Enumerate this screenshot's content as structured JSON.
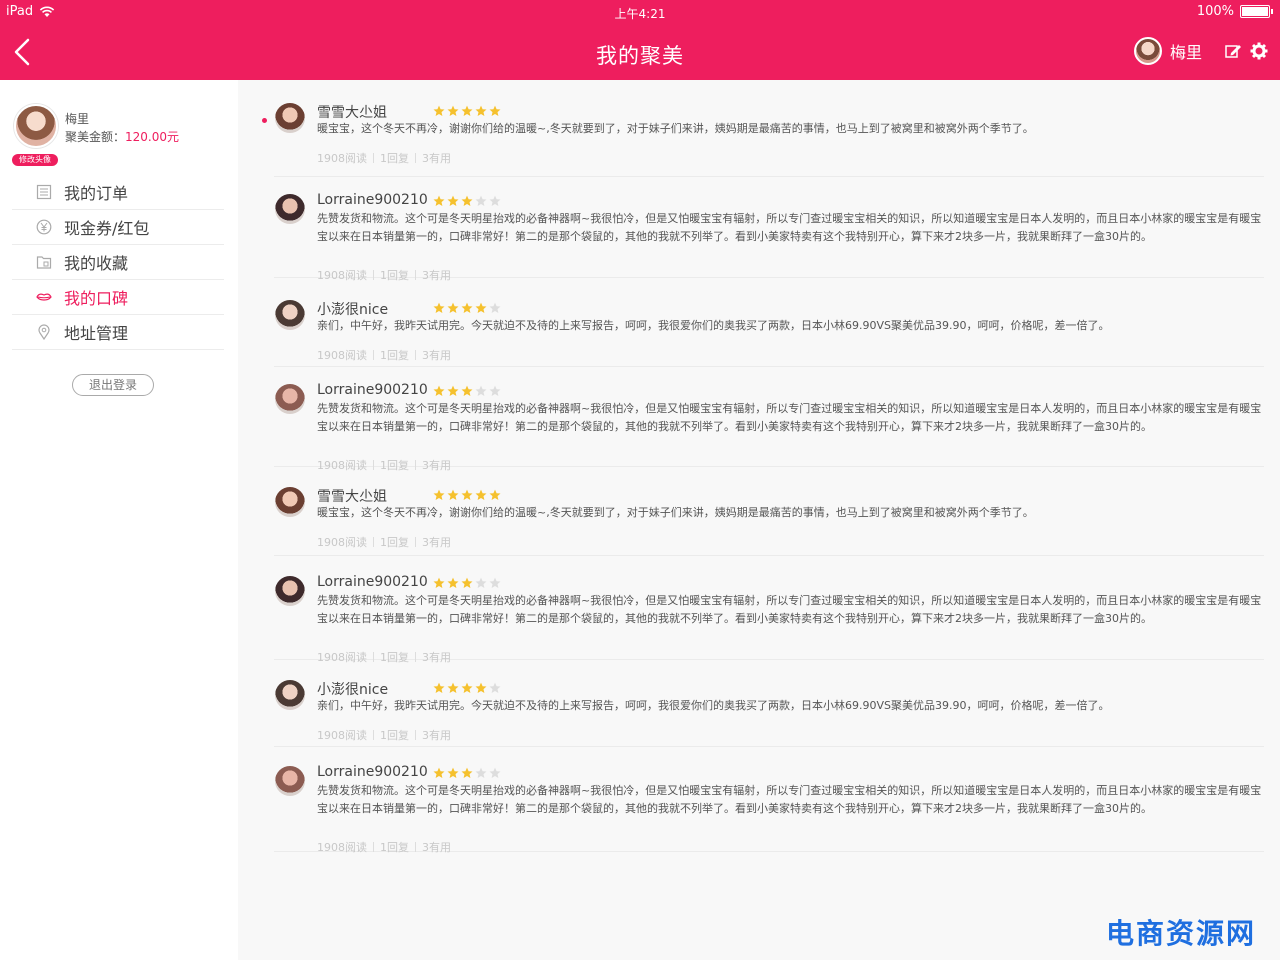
{
  "status_bar": {
    "device": "iPad",
    "time": "上午4:21",
    "battery": "100%"
  },
  "nav": {
    "title": "我的聚美",
    "username": "梅里"
  },
  "profile": {
    "name": "梅里",
    "money_label": "聚美金额：",
    "money_value": "120.00元",
    "edit_avatar_label": "修改头像"
  },
  "menu": [
    {
      "label": "我的订单",
      "icon": "order-icon"
    },
    {
      "label": "现金券/红包",
      "icon": "yen-icon"
    },
    {
      "label": "我的收藏",
      "icon": "favorites-icon"
    },
    {
      "label": "我的口碑",
      "icon": "lips-icon",
      "active": true
    },
    {
      "label": "地址管理",
      "icon": "location-icon"
    }
  ],
  "logout_label": "退出登录",
  "reviews": [
    {
      "user": "雪雪大尐姐",
      "rating": 5,
      "unread": true,
      "text": "暖宝宝，这个冬天不再冷，谢谢你们给的温暖~,冬天就要到了，对于妹子们来讲，姨妈期是最痛苦的事情，也马上到了被窝里和被窝外两个季节了。",
      "reads": "1908阅读",
      "replies": "1回复",
      "useful": "3有用"
    },
    {
      "user": "Lorraine900210",
      "rating": 3,
      "text": "先赞发货和物流。这个可是冬天明星抬戏的必备神器啊~我很怕冷，但是又怕暖宝宝有辐射，所以专门查过暖宝宝相关的知识，所以知道暖宝宝是日本人发明的，而且日本小林家的暖宝宝是有暖宝宝以来在日本销量第一的，口碑非常好！第二的是那个袋鼠的，其他的我就不列举了。看到小美家特卖有这个我特别开心，算下来才2块多一片，我就果断拜了一盒30片的。",
      "reads": "1908阅读",
      "replies": "1回复",
      "useful": "3有用"
    },
    {
      "user": "小澎很nice",
      "rating": 4,
      "text": "亲们，中午好，我昨天试用完。今天就迫不及待的上来写报告，呵呵，我很爱你们的奥我买了两款，日本小林69.90VS聚美优品39.90，呵呵，价格呢，差一倍了。",
      "reads": "1908阅读",
      "replies": "1回复",
      "useful": "3有用"
    },
    {
      "user": "Lorraine900210",
      "rating": 3,
      "text": "先赞发货和物流。这个可是冬天明星抬戏的必备神器啊~我很怕冷，但是又怕暖宝宝有辐射，所以专门查过暖宝宝相关的知识，所以知道暖宝宝是日本人发明的，而且日本小林家的暖宝宝是有暖宝宝以来在日本销量第一的，口碑非常好！第二的是那个袋鼠的，其他的我就不列举了。看到小美家特卖有这个我特别开心，算下来才2块多一片，我就果断拜了一盒30片的。",
      "reads": "1908阅读",
      "replies": "1回复",
      "useful": "3有用"
    },
    {
      "user": "雪雪大尐姐",
      "rating": 5,
      "text": "暖宝宝，这个冬天不再冷，谢谢你们给的温暖~,冬天就要到了，对于妹子们来讲，姨妈期是最痛苦的事情，也马上到了被窝里和被窝外两个季节了。",
      "reads": "1908阅读",
      "replies": "1回复",
      "useful": "3有用"
    },
    {
      "user": "Lorraine900210",
      "rating": 3,
      "text": "先赞发货和物流。这个可是冬天明星抬戏的必备神器啊~我很怕冷，但是又怕暖宝宝有辐射，所以专门查过暖宝宝相关的知识，所以知道暖宝宝是日本人发明的，而且日本小林家的暖宝宝是有暖宝宝以来在日本销量第一的，口碑非常好！第二的是那个袋鼠的，其他的我就不列举了。看到小美家特卖有这个我特别开心，算下来才2块多一片，我就果断拜了一盒30片的。",
      "reads": "1908阅读",
      "replies": "1回复",
      "useful": "3有用"
    },
    {
      "user": "小澎很nice",
      "rating": 4,
      "text": "亲们，中午好，我昨天试用完。今天就迫不及待的上来写报告，呵呵，我很爱你们的奥我买了两款，日本小林69.90VS聚美优品39.90，呵呵，价格呢，差一倍了。",
      "reads": "1908阅读",
      "replies": "1回复",
      "useful": "3有用"
    },
    {
      "user": "Lorraine900210",
      "rating": 3,
      "text": "先赞发货和物流。这个可是冬天明星抬戏的必备神器啊~我很怕冷，但是又怕暖宝宝有辐射，所以专门查过暖宝宝相关的知识，所以知道暖宝宝是日本人发明的，而且日本小林家的暖宝宝是有暖宝宝以来在日本销量第一的，口碑非常好！第二的是那个袋鼠的，其他的我就不列举了。看到小美家特卖有这个我特别开心，算下来才2块多一片，我就果断拜了一盒30片的。",
      "reads": "1908阅读",
      "replies": "1回复",
      "useful": "3有用"
    }
  ],
  "watermark": "电商资源网",
  "colors": {
    "brand": "#ee1e5e",
    "star": "#f5c12e",
    "star_empty": "#dddddd"
  }
}
